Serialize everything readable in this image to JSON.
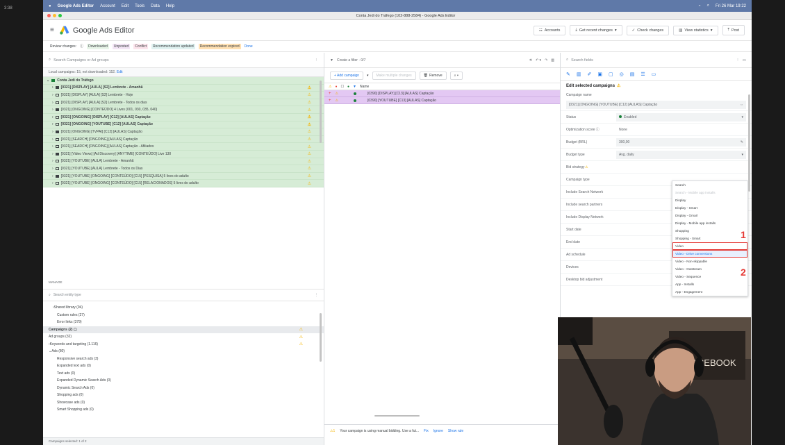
{
  "side_time": "3:38",
  "macmenu": {
    "app": "Google Ads Editor",
    "items": [
      "Account",
      "Edit",
      "Tools",
      "Data",
      "Help"
    ],
    "clock": "Fri 26 Mar 19:22"
  },
  "window_title": "Conta Jedi do Tráfego (102-888-2584) - Google Ads Editor",
  "app_name": "Google Ads Editor",
  "toolbar": {
    "accounts": "Accounts",
    "get_recent": "Get recent changes",
    "check_changes": "Check changes",
    "view_stats": "View statistics",
    "post": "Post"
  },
  "review": {
    "label": "Review changes:",
    "chips": [
      {
        "text": "Downloaded",
        "bg": "#e8f5e9"
      },
      {
        "text": "Unposted",
        "bg": "#f3e5f5"
      },
      {
        "text": "Conflict",
        "bg": "#fce4ec"
      },
      {
        "text": "Recommendation updated",
        "bg": "#e0f2f1"
      },
      {
        "text": "Recommendation expired",
        "bg": "#ffe0b2"
      }
    ],
    "done": "Done"
  },
  "left": {
    "search_placeholder": "Search Campaigns or Ad groups",
    "notice": "Local campaigns: 15, not downloaded: 152.",
    "notice_link": "Edit",
    "account": "Conta Jedi do Tráfego",
    "campaigns": [
      {
        "name": "[0321] [DISPLAY] [AULA] [S2] Lembrete - Amanhã",
        "bold": true,
        "warn": true
      },
      {
        "name": "[0321] [DISPLAY] [AULA] [S2] Lembrete - Hoje",
        "bold": false,
        "warn": true
      },
      {
        "name": "[0321] [DISPLAY] [AULA] [S2] Lembrete - Todos os dias",
        "bold": false,
        "warn": true
      },
      {
        "name": "[0321] [ONGOING] [CONTEÚDO] 4 Lives (001, 030, 035, 040)",
        "bold": false,
        "warn": true
      },
      {
        "name": "[0321] [ONGOING] [DISPLAY] [C12] [AULAS] Captação",
        "bold": true,
        "warn": true
      },
      {
        "name": "[0321] [ONGOING] [YOUTUBE] [C12] [AULAS] Captação",
        "bold": true,
        "warn": true
      },
      {
        "name": "[0321] [ONGOING] [TVPAI] [C12] [AULAS] Captação",
        "bold": false,
        "warn": true
      },
      {
        "name": "[0321] [SEARCH] [ONGOING] [AULAS] Captação",
        "bold": false,
        "warn": true
      },
      {
        "name": "[0321] [SEARCH] [ONGOING] [AULAS] Captação - Afiliados",
        "bold": false,
        "warn": true
      },
      {
        "name": "[0321] [Video Views] [Ad Discovery] [ANYTIME] [CONTEÚDO] Live 130",
        "bold": false,
        "warn": true
      },
      {
        "name": "[0321] [YOUTUBE] [AULA] Lembrete - Amanhã",
        "bold": false,
        "warn": true
      },
      {
        "name": "[0321] [YOUTUBE] [AULA] Lembrete - Todos os Dias",
        "bold": false,
        "warn": true
      },
      {
        "name": "[0321] [YOUTUBE] [ONGOING] [CONTEÚDO] [C15] [PESQUISA] 5 lives do adulto",
        "bold": false,
        "warn": true
      },
      {
        "name": "[0321] [YOUTUBE] [ONGOING] [CONTEÚDO] [C15] [RELACIONADOS] 5 lives do adulto",
        "bold": false,
        "warn": true
      }
    ],
    "manager_label": "MANAGE",
    "manager_search": "Search entity type",
    "manager_items": [
      {
        "text": "Shared library (94)",
        "indent": 1,
        "arrow": "›",
        "sel": false,
        "warn": false
      },
      {
        "text": "Custom rules (27)",
        "indent": 2,
        "arrow": "",
        "sel": false,
        "warn": false
      },
      {
        "text": "Error links (379)",
        "indent": 2,
        "arrow": "",
        "sel": false,
        "warn": false
      },
      {
        "text": "Campaigns (2) ▢",
        "indent": 0,
        "arrow": "",
        "sel": true,
        "warn": true
      },
      {
        "text": "Ad groups (32)",
        "indent": 0,
        "arrow": "",
        "sel": false,
        "warn": true
      },
      {
        "text": "Keywords and targeting (1.116)",
        "indent": 0,
        "arrow": "›",
        "sel": false,
        "warn": true
      },
      {
        "text": "Ads (80)",
        "indent": 0,
        "arrow": "⌄",
        "sel": false,
        "warn": false
      },
      {
        "text": "Responsive search ads (3)",
        "indent": 2,
        "arrow": "",
        "sel": false,
        "warn": false
      },
      {
        "text": "Expanded text ads (0)",
        "indent": 2,
        "arrow": "",
        "sel": false,
        "warn": false
      },
      {
        "text": "Text ads (0)",
        "indent": 2,
        "arrow": "",
        "sel": false,
        "warn": false
      },
      {
        "text": "Expanded Dynamic Search Ads (0)",
        "indent": 2,
        "arrow": "",
        "sel": false,
        "warn": false
      },
      {
        "text": "Dynamic Search Ads (0)",
        "indent": 2,
        "arrow": "",
        "sel": false,
        "warn": false
      },
      {
        "text": "Shopping ads (0)",
        "indent": 2,
        "arrow": "",
        "sel": false,
        "warn": false
      },
      {
        "text": "Showcase ads (0)",
        "indent": 2,
        "arrow": "",
        "sel": false,
        "warn": false
      },
      {
        "text": "Smart Shopping ads (0)",
        "indent": 2,
        "arrow": "",
        "sel": false,
        "warn": false
      }
    ],
    "status": "Campaigns selected: 1 of 2"
  },
  "mid": {
    "filter": "Create a filter · 0/7",
    "add_campaign": "+ Add campaign",
    "make_changes": "Make multiple changes",
    "remove": "Remove",
    "col_header": "Name",
    "rows": [
      "[0390] [DISPLAY] [C13] [AULAS] Captação",
      "[0390] [YOUTUBE] [C13] [AULAS] Captação"
    ],
    "status_msg": "Your campaign is using manual bidding. Use a fut...",
    "fix": "Fix",
    "ignore": "Ignore",
    "show_rule": "Show rule"
  },
  "right": {
    "search_placeholder": "Search fields",
    "edit_title": "Edit selected campaigns",
    "campaign_name_label": "Campaign name",
    "campaign_name": "[0321] [ONGOING] [YOUTUBE] [C12] [AULAS] Captação",
    "fields": [
      {
        "label": "Status",
        "value": "Enabled"
      },
      {
        "label": "Optimization score ⓘ",
        "value": "None"
      },
      {
        "label": "Budget (BRL)",
        "value": "300,00"
      },
      {
        "label": "Budget type",
        "value": "Avg. daily"
      },
      {
        "label": "Bid strategy",
        "value": ""
      },
      {
        "label": "Campaign type",
        "value": ""
      },
      {
        "label": "Include Search Network",
        "value": ""
      },
      {
        "label": "Include search partners",
        "value": ""
      },
      {
        "label": "Include Display Network",
        "value": ""
      },
      {
        "label": "Start date",
        "value": ""
      },
      {
        "label": "End date",
        "value": ""
      },
      {
        "label": "Ad schedule",
        "value": ""
      },
      {
        "label": "Devices",
        "value": ""
      },
      {
        "label": "Desktop bid adjustment",
        "value": ""
      }
    ],
    "dropdown": [
      {
        "text": "Search",
        "style": ""
      },
      {
        "text": "Search - Mobile app installs",
        "style": "muted"
      },
      {
        "text": "Display",
        "style": ""
      },
      {
        "text": "Display - Smart",
        "style": ""
      },
      {
        "text": "Display - Gmail",
        "style": ""
      },
      {
        "text": "Display - Mobile app installs",
        "style": ""
      },
      {
        "text": "Shopping",
        "style": ""
      },
      {
        "text": "Shopping - Smart",
        "style": ""
      },
      {
        "text": "Video",
        "style": "boxed"
      },
      {
        "text": "Video - Drive conversions",
        "style": "boxed hl"
      },
      {
        "text": "Video - Non-skippable",
        "style": ""
      },
      {
        "text": "Video - Outstream",
        "style": ""
      },
      {
        "text": "Video - Sequence",
        "style": ""
      },
      {
        "text": "App - Installs",
        "style": ""
      },
      {
        "text": "App - Engagement",
        "style": ""
      }
    ],
    "marker1": "1",
    "marker2": "2"
  },
  "webcam_sign": "FACEBOOK"
}
